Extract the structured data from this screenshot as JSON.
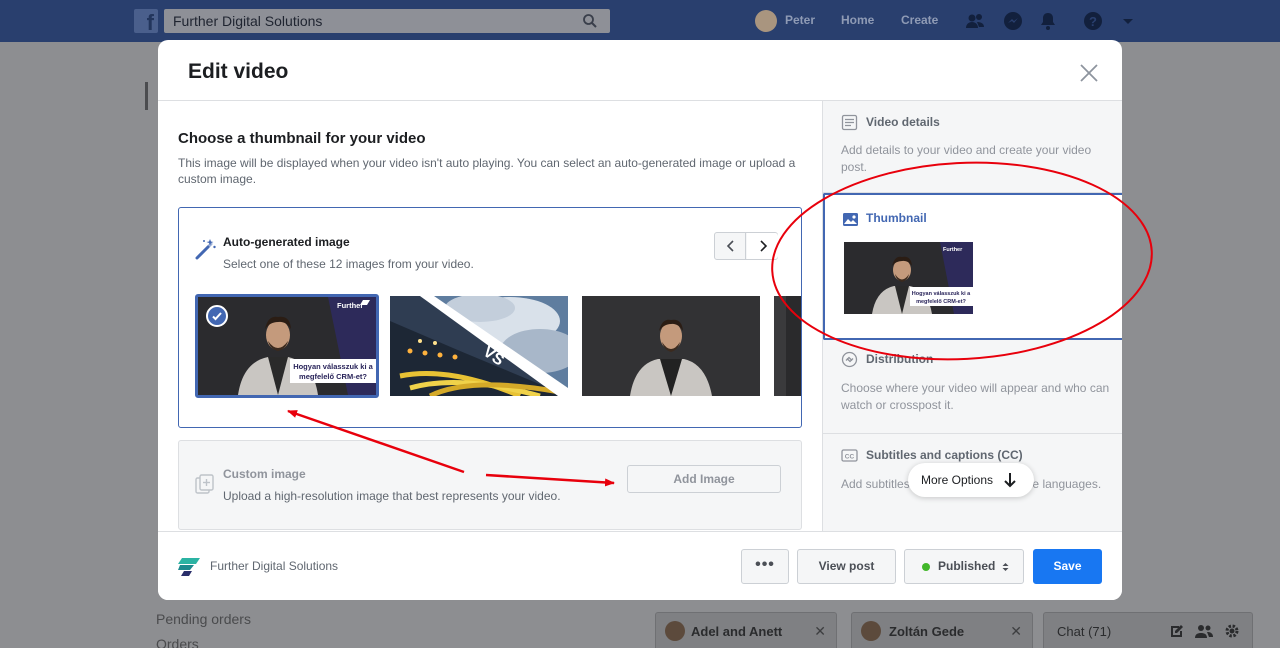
{
  "topbar": {
    "search_value": "Further Digital Solutions",
    "user_name": "Peter",
    "home": "Home",
    "create": "Create"
  },
  "background": {
    "left_items": [
      "Pending orders",
      "Orders"
    ]
  },
  "chat_dock": {
    "conversations": [
      "Adel and Anett",
      "Zoltán Gede"
    ],
    "chat_label": "Chat (71)"
  },
  "modal": {
    "title": "Edit video",
    "section_title": "Choose a thumbnail for your video",
    "section_desc": "This image will be displayed when your video isn't auto playing. You can select an auto-generated image or upload a custom image.",
    "auto": {
      "title": "Auto-generated image",
      "desc": "Select one of these 12 images from your video.",
      "overlay_brand": "Further",
      "overlay_caption": "Hogyan válasszuk ki a megfelelő CRM-et?"
    },
    "custom": {
      "title": "Custom image",
      "desc": "Upload a high-resolution image that best represents your video.",
      "button": "Add Image"
    }
  },
  "side_panel": {
    "video_details": {
      "title": "Video details",
      "desc": "Add details to your video and create your video post."
    },
    "thumbnail": {
      "title": "Thumbnail"
    },
    "distribution": {
      "title": "Distribution",
      "desc": "Choose where your video will appear and who can watch or crosspost it."
    },
    "subtitles": {
      "title": "Subtitles and captions (CC)",
      "desc": "Add subtitles to your video in multiple languages."
    },
    "more_options": "More Options"
  },
  "footer": {
    "page_name": "Further Digital Solutions",
    "dots": "•••",
    "view_post": "View post",
    "status": "Published",
    "save": "Save"
  },
  "colors": {
    "accent": "#4267b2",
    "save_blue": "#1877f2",
    "annotation_red": "#e8000c",
    "status_green": "#42b72a"
  }
}
